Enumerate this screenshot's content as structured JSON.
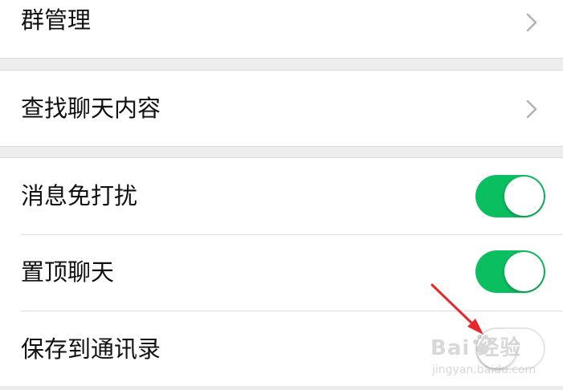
{
  "settings": {
    "group_manage": "群管理",
    "search_chat": "查找聊天内容",
    "mute": {
      "label": "消息免打扰",
      "state": "on"
    },
    "pin": {
      "label": "置顶聊天",
      "state": "on"
    },
    "save_contacts": {
      "label": "保存到通讯录",
      "state": "off"
    }
  },
  "watermark": {
    "brand": "Bai 经验",
    "url": "jingyan.baidu.com"
  },
  "colors": {
    "toggle_on": "#0bbe5f",
    "arrow": "#e8262b",
    "background": "#ededed"
  },
  "icons": {
    "chevron": "chevron-right-icon",
    "paw": "paw-icon",
    "arrow": "pointer-arrow-icon"
  }
}
